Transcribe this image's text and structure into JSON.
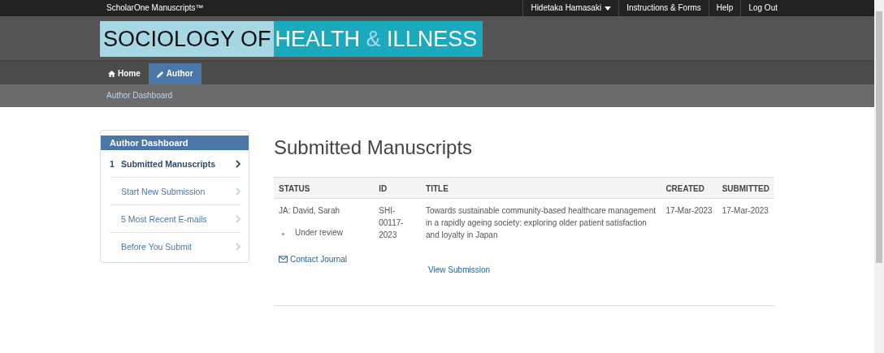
{
  "top_bar": {
    "brand": "ScholarOne Manuscripts™",
    "menu": [
      {
        "label": "Hidetaka Hamasaki",
        "kind": "dropdown"
      },
      {
        "label": "Instructions & Forms",
        "kind": "link"
      },
      {
        "label": "Help",
        "kind": "link"
      },
      {
        "label": "Log Out",
        "kind": "link"
      }
    ]
  },
  "logo": {
    "left": "SOCIOLOGY OF",
    "right_1": "HEALTH",
    "amp": "&",
    "right_2": "ILLNESS"
  },
  "tabs": [
    {
      "label": "Home",
      "kind": "home",
      "selected": false
    },
    {
      "label": "Author",
      "kind": "edit",
      "selected": true
    }
  ],
  "breadcrumb": "Author Dashboard",
  "sidebar": {
    "title": "Author Dashboard",
    "items": [
      {
        "number": "1",
        "label": "Submitted Manuscripts",
        "selected": true
      },
      {
        "label": "Start New Submission",
        "selected": false
      },
      {
        "label": "5 Most Recent E-mails",
        "selected": false
      },
      {
        "label": "Before You Submit",
        "selected": false
      }
    ]
  },
  "heading": "Submitted Manuscripts",
  "table": {
    "columns": [
      "STATUS",
      "ID",
      "TITLE",
      "CREATED",
      "SUBMITTED"
    ],
    "rows": [
      {
        "editor": "JA: David, Sarah",
        "status": "Under review",
        "contact": "Contact Journal",
        "id": "SHI-00117-2023",
        "title": "Towards sustainable community-based healthcare management in a rapidly ageing society: exploring older patient satisfaction and loyalty in Japan",
        "view": "View Submission",
        "created": "17-Mar-2023",
        "submitted": "17-Mar-2023"
      }
    ]
  }
}
